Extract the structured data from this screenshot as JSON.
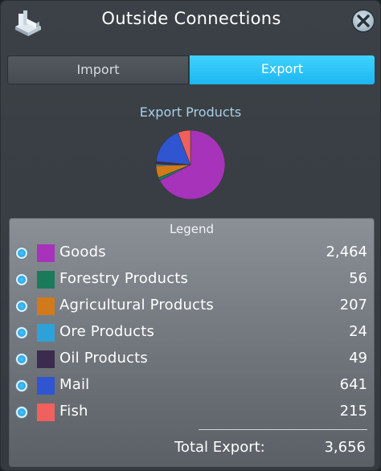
{
  "window": {
    "title": "Outside Connections"
  },
  "tabs": [
    {
      "label": "Import",
      "active": false
    },
    {
      "label": "Export",
      "active": true
    }
  ],
  "chart_data": {
    "type": "pie",
    "title": "Export Products",
    "slices": [
      {
        "label": "Goods",
        "value": 2464,
        "color": "#a633b9"
      },
      {
        "label": "Forestry Products",
        "value": 56,
        "color": "#1a7a5a"
      },
      {
        "label": "Agricultural Products",
        "value": 207,
        "color": "#d07a1c"
      },
      {
        "label": "Ore Products",
        "value": 24,
        "color": "#2ea1d8"
      },
      {
        "label": "Oil Products",
        "value": 49,
        "color": "#3b2b4f"
      },
      {
        "label": "Mail",
        "value": 641,
        "color": "#2f55d0"
      },
      {
        "label": "Fish",
        "value": 215,
        "color": "#f0605e"
      }
    ]
  },
  "legend": {
    "title": "Legend",
    "items": [
      {
        "label": "Goods",
        "value": "2,464",
        "color": "#a633b9"
      },
      {
        "label": "Forestry Products",
        "value": "56",
        "color": "#1a7a5a"
      },
      {
        "label": "Agricultural Products",
        "value": "207",
        "color": "#d07a1c"
      },
      {
        "label": "Ore Products",
        "value": "24",
        "color": "#2ea1d8"
      },
      {
        "label": "Oil Products",
        "value": "49",
        "color": "#3b2b4f"
      },
      {
        "label": "Mail",
        "value": "641",
        "color": "#2f55d0"
      },
      {
        "label": "Fish",
        "value": "215",
        "color": "#f0605e"
      }
    ],
    "total_label": "Total Export:",
    "total_value": "3,656"
  },
  "icons": {
    "app": "factory-icon",
    "close": "close-icon"
  }
}
